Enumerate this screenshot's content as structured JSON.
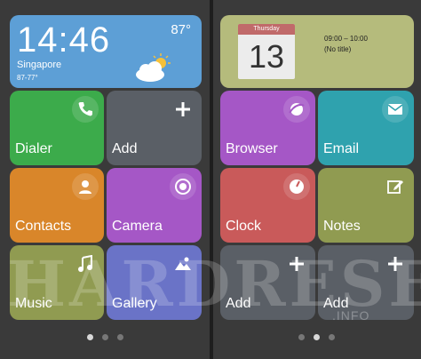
{
  "left_screen": {
    "weather": {
      "time": "14:46",
      "temperature": "87°",
      "city": "Singapore",
      "range": "87-77°",
      "icon": "partly-cloudy-icon"
    },
    "tiles": [
      {
        "label": "Dialer",
        "icon": "phone-icon",
        "color": "#3cab4b"
      },
      {
        "label": "Add",
        "icon": "plus-icon",
        "color": "#5a5f66"
      },
      {
        "label": "Contacts",
        "icon": "person-icon",
        "color": "#d9862a"
      },
      {
        "label": "Camera",
        "icon": "camera-icon",
        "color": "#a557c6"
      },
      {
        "label": "Music",
        "icon": "music-note-icon",
        "color": "#909b51"
      },
      {
        "label": "Gallery",
        "icon": "image-icon",
        "color": "#6a73c7"
      }
    ],
    "page_indicator": {
      "pages": 3,
      "active": 1
    }
  },
  "right_screen": {
    "calendar": {
      "weekday": "Thursday",
      "date": "13",
      "time_range": "09:00 – 10:00",
      "event": "(No title)"
    },
    "tiles": [
      {
        "label": "Browser",
        "icon": "globe-icon",
        "color": "#a557c6"
      },
      {
        "label": "Email",
        "icon": "envelope-icon",
        "color": "#2fa2ae"
      },
      {
        "label": "Clock",
        "icon": "clock-icon",
        "color": "#c95a5a"
      },
      {
        "label": "Notes",
        "icon": "edit-note-icon",
        "color": "#909b51"
      },
      {
        "label": "Add",
        "icon": "plus-icon",
        "color": "#5a5f66"
      },
      {
        "label": "Add",
        "icon": "plus-icon",
        "color": "#5a5f66"
      }
    ],
    "page_indicator": {
      "pages": 3,
      "active": 2
    }
  },
  "watermark": {
    "text": "HARDRESET",
    "suffix": ".INFO"
  }
}
